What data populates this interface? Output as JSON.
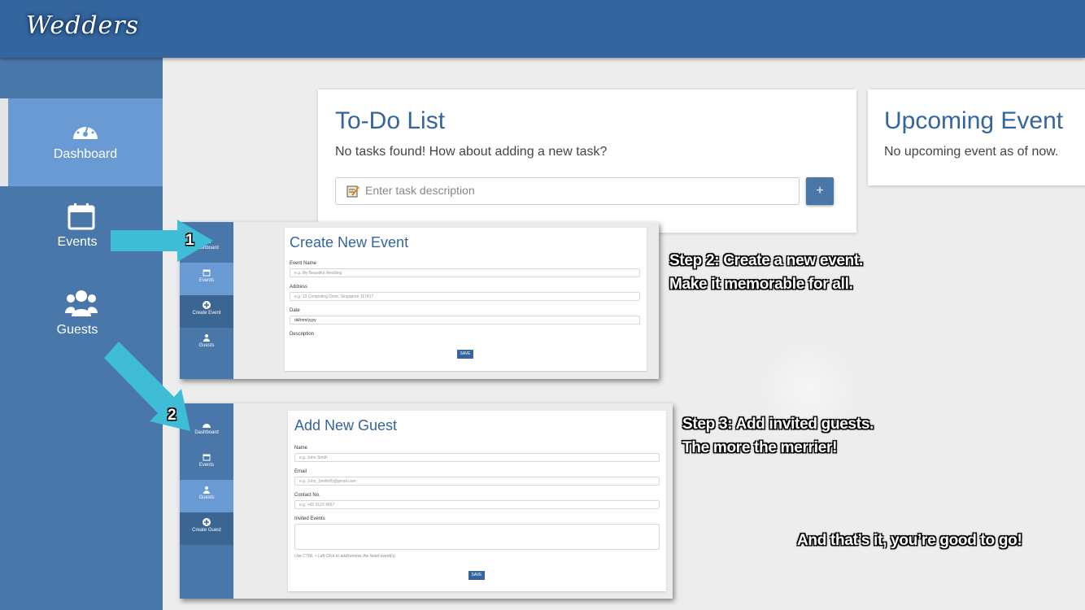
{
  "app": {
    "logo": "Wedders"
  },
  "sidebar": {
    "items": [
      {
        "label": "Dashboard",
        "icon": "dashboard-gauge-icon",
        "active": true
      },
      {
        "label": "Events",
        "icon": "calendar-icon",
        "active": false
      },
      {
        "label": "Guests",
        "icon": "users-icon",
        "active": false
      }
    ]
  },
  "todo": {
    "title": "To-Do List",
    "empty_message": "No tasks found! How about adding a new task?",
    "input_placeholder": "Enter task description",
    "add_label": "+"
  },
  "upcoming": {
    "title": "Upcoming Event",
    "empty_message": "No upcoming event as of now."
  },
  "tutorial": {
    "step1_number": "1",
    "step2_number": "2",
    "step2_line1": "Step 2: Create a new event.",
    "step2_line2": "Make it memorable for all.",
    "step3_line1": "Step 3: Add invited guests.",
    "step3_line2": "The more the merrier!",
    "closing": "And that’s it, you’re good to go!"
  },
  "create_event_shot": {
    "sidebar": [
      "Dashboard",
      "Events",
      "Create Event",
      "Guests"
    ],
    "title": "Create New Event",
    "fields": [
      {
        "label": "Event Name",
        "placeholder": "e.g. My Beautiful Wedding"
      },
      {
        "label": "Address",
        "placeholder": "e.g. 13 Computing Drive, Singapore 117417"
      },
      {
        "label": "Date",
        "placeholder": "dd/mm/yyyy"
      },
      {
        "label": "Description",
        "placeholder": ""
      }
    ],
    "save_label": "SAVE"
  },
  "add_guest_shot": {
    "sidebar": [
      "Dashboard",
      "Events",
      "Guests",
      "Create Guest"
    ],
    "title": "Add New Guest",
    "fields": [
      {
        "label": "Name",
        "placeholder": "e.g. John Smith"
      },
      {
        "label": "Email",
        "placeholder": "e.g. John_Smith95@gmail.com"
      },
      {
        "label": "Contact No.",
        "placeholder": "e.g. +65 9123 4567"
      },
      {
        "label": "Invited Events",
        "placeholder": ""
      }
    ],
    "hint": "Use CTRL + Left Click to add/remove the listed event(s).",
    "save_label": "SAVE"
  },
  "colors": {
    "primary": "#34659e",
    "sidebar": "#4a77aa",
    "active": "#6a9ad3",
    "arrow": "#3fbcd6"
  }
}
